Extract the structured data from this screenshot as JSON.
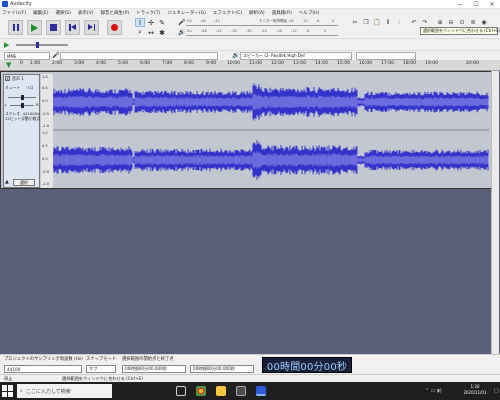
{
  "window": {
    "title": "Audacity",
    "minimize": "—",
    "maximize": "☐",
    "close": "✕"
  },
  "menu": [
    "ファイル(F)",
    "編集(E)",
    "選択(S)",
    "表示(V)",
    "録音と再生(P)",
    "トラック(T)",
    "ジェネレーター(G)",
    "エフェクト(C)",
    "解析(A)",
    "道具箱(R)",
    "ヘルプ(H)"
  ],
  "meters": {
    "record_scale": [
      "-54",
      "-48",
      "-42",
      "",
      "-18",
      "-12",
      "-6",
      "0"
    ],
    "record_message": "モニター取得開始",
    "play_scale": [
      "-54",
      "-48",
      "-42",
      "-36",
      "-30",
      "-24",
      "-18",
      "-12",
      "-6",
      "0"
    ]
  },
  "tooltip": "選択範囲をウィンドウに合わせる (Ctrl+E)",
  "device": {
    "host": "MME",
    "output": "スピーカー (2- Realtek High Def"
  },
  "ruler": {
    "ticks": [
      "0",
      "1:00",
      "2:00",
      "3:00",
      "4:00",
      "5:00",
      "6:00",
      "7:00",
      "8:00",
      "9:00",
      "10:00",
      "11:00",
      "12:00",
      "13:00",
      "14:00",
      "15:00",
      "16:00",
      "17:00",
      "18:00",
      "19:00",
      "20:00"
    ]
  },
  "track": {
    "close": "x",
    "name": "音声 1",
    "mute": "ミュート",
    "solo": "ソロ",
    "left": "L",
    "right": "R",
    "info": "ステレオ, 44100Hz",
    "info2": "32ビット浮動小数点",
    "select": "選択",
    "scale": [
      "1.0",
      "0.5",
      "0.0",
      "-0.5",
      "-1.0",
      "1.0",
      "0.5",
      "0.0",
      "-0.5",
      "-1.0"
    ]
  },
  "selection": {
    "rate_label": "プロジェクトのサンプリング周波数 (Hz)",
    "rate_value": "44100",
    "snap_label": "スナップモード",
    "snap_value": "オフ",
    "range_label": "選択範囲の開始点と終了点",
    "start": "00時間00分00.000秒",
    "end": "00時間00分00.000秒",
    "big_time": "00時間00分00秒"
  },
  "status": {
    "left": "停止",
    "right": "選択範囲をウィンドウに合わせる (Ctrl+E)"
  },
  "taskbar": {
    "search_placeholder": "ここに入力して検索",
    "time": "1:30",
    "date": "2020/11/01"
  },
  "colors": {
    "waveform": "#3333cc",
    "waveform_rms": "#6b6bdd",
    "track_bg": "#c3c7cf",
    "project_bg": "#5a5f7a"
  }
}
